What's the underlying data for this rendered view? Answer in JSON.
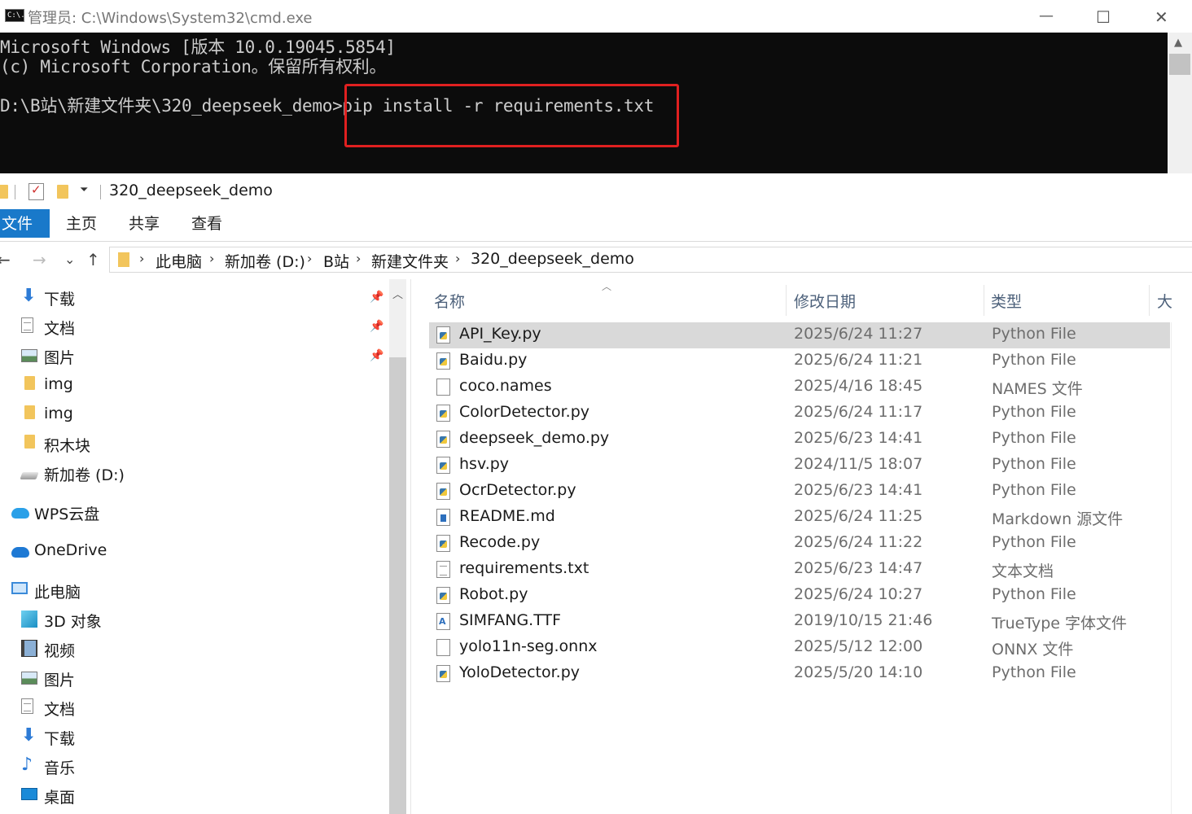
{
  "cmd": {
    "title": "管理员: C:\\Windows\\System32\\cmd.exe",
    "icon_text": "C:\\.",
    "lines": [
      "Microsoft Windows [版本 10.0.19045.5854]",
      "(c) Microsoft Corporation。保留所有权利。",
      "D:\\B站\\新建文件夹\\320_deepseek_demo>pip install -r requirements.txt"
    ]
  },
  "window_controls": {
    "minimize": "—",
    "maximize": "☐",
    "close": "✕"
  },
  "explorer": {
    "title": "320_deepseek_demo",
    "ribbon_tabs": [
      "文件",
      "主页",
      "共享",
      "查看"
    ],
    "nav_icons": {
      "back": "←",
      "forward": "→",
      "recent": "⌄",
      "up": "↑"
    },
    "breadcrumb": [
      "此电脑",
      "新加卷 (D:)",
      "B站",
      "新建文件夹",
      "320_deepseek_demo"
    ],
    "nav_pane": [
      {
        "label": "下载",
        "icon": "download-icon"
      },
      {
        "label": "文档",
        "icon": "document-icon"
      },
      {
        "label": "图片",
        "icon": "picture-icon"
      },
      {
        "label": "img",
        "icon": "folder-icon"
      },
      {
        "label": "img",
        "icon": "folder-icon"
      },
      {
        "label": "积木块",
        "icon": "folder-icon"
      },
      {
        "label": "新加卷 (D:)",
        "icon": "drive-icon"
      },
      {
        "label": "WPS云盘",
        "icon": "wps-cloud-icon"
      },
      {
        "label": "OneDrive",
        "icon": "onedrive-icon"
      },
      {
        "label": "此电脑",
        "icon": "computer-icon"
      },
      {
        "label": "3D 对象",
        "icon": "3d-objects-icon"
      },
      {
        "label": "视频",
        "icon": "video-icon"
      },
      {
        "label": "图片",
        "icon": "picture-icon"
      },
      {
        "label": "文档",
        "icon": "document-icon"
      },
      {
        "label": "下载",
        "icon": "download-icon"
      },
      {
        "label": "音乐",
        "icon": "music-icon"
      },
      {
        "label": "桌面",
        "icon": "desktop-icon"
      }
    ],
    "columns": {
      "name": "名称",
      "date": "修改日期",
      "type": "类型",
      "size": "大"
    },
    "files": [
      {
        "name": "API_Key.py",
        "date": "2025/6/24 11:27",
        "type": "Python File",
        "icon": "python-file-icon"
      },
      {
        "name": "Baidu.py",
        "date": "2025/6/24 11:21",
        "type": "Python File",
        "icon": "python-file-icon"
      },
      {
        "name": "coco.names",
        "date": "2025/4/16 18:45",
        "type": "NAMES 文件",
        "icon": "blank-file-icon"
      },
      {
        "name": "ColorDetector.py",
        "date": "2025/6/24 11:17",
        "type": "Python File",
        "icon": "python-file-icon"
      },
      {
        "name": "deepseek_demo.py",
        "date": "2025/6/23 14:41",
        "type": "Python File",
        "icon": "python-file-icon"
      },
      {
        "name": "hsv.py",
        "date": "2024/11/5 18:07",
        "type": "Python File",
        "icon": "python-file-icon"
      },
      {
        "name": "OcrDetector.py",
        "date": "2025/6/23 14:41",
        "type": "Python File",
        "icon": "python-file-icon"
      },
      {
        "name": "README.md",
        "date": "2025/6/24 11:25",
        "type": "Markdown 源文件",
        "icon": "markdown-file-icon"
      },
      {
        "name": "Recode.py",
        "date": "2025/6/24 11:22",
        "type": "Python File",
        "icon": "python-file-icon"
      },
      {
        "name": "requirements.txt",
        "date": "2025/6/23 14:47",
        "type": "文本文档",
        "icon": "text-file-icon"
      },
      {
        "name": "Robot.py",
        "date": "2025/6/24 10:27",
        "type": "Python File",
        "icon": "python-file-icon"
      },
      {
        "name": "SIMFANG.TTF",
        "date": "2019/10/15 21:46",
        "type": "TrueType 字体文件",
        "icon": "font-file-icon"
      },
      {
        "name": "yolo11n-seg.onnx",
        "date": "2025/5/12 12:00",
        "type": "ONNX 文件",
        "icon": "blank-file-icon"
      },
      {
        "name": "YoloDetector.py",
        "date": "2025/5/20 14:10",
        "type": "Python File",
        "icon": "python-file-icon"
      }
    ],
    "selected_file": "API_Key.py"
  },
  "colors": {
    "highlight_box": "#e02020",
    "file_tab": "#1979ca",
    "cmd_background": "#0c0c0c"
  }
}
